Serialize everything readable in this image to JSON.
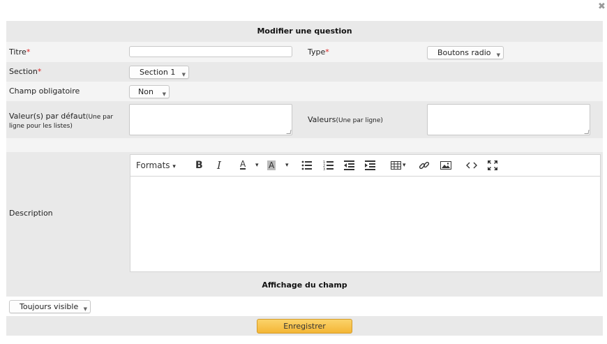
{
  "dialog": {
    "close_label": "✖",
    "header_title": "Modifier une question",
    "fields": {
      "titre_label": "Titre",
      "titre_value": "",
      "type_label": "Type",
      "type_value": "Boutons radio",
      "section_label": "Section",
      "section_value": "Section 1",
      "required_label": "Champ obligatoire",
      "required_value": "Non",
      "default_label": "Valeur(s) par défaut",
      "default_hint": "(Une par ligne pour les listes)",
      "values_label": "Valeurs",
      "values_hint": "(Une par ligne)",
      "description_label": "Description",
      "required_marker": "*"
    },
    "editor": {
      "formats_label": "Formats",
      "caret": "▾",
      "bold": "B",
      "italic": "I",
      "text_color": "A",
      "bg_color": "A",
      "content": ""
    },
    "display_section_title": "Affichage du champ",
    "visibility_value": "Toujours visible",
    "save_label": "Enregistrer"
  },
  "colors": {
    "accent": "#f4b636",
    "required": "#d22222",
    "row_gray": "#e9e9e9",
    "row_light": "#f4f4f4"
  }
}
